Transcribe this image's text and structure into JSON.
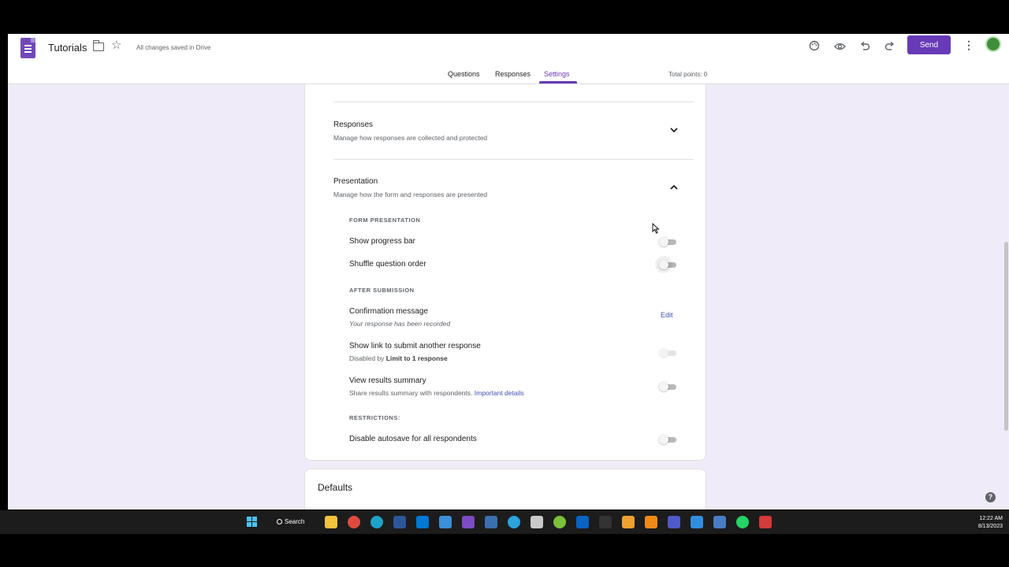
{
  "header": {
    "title": "Tutorials",
    "save_status": "All changes saved in Drive",
    "send_label": "Send",
    "icons": [
      "palette-icon",
      "preview-eye-icon",
      "undo-icon",
      "redo-icon",
      "more-vert-icon"
    ]
  },
  "tabs": [
    {
      "label": "Questions"
    },
    {
      "label": "Responses"
    },
    {
      "label": "Settings",
      "active": true
    }
  ],
  "total_points": "Total points: 0",
  "sections": {
    "responses": {
      "title": "Responses",
      "subtitle": "Manage how responses are collected and protected",
      "expanded": false
    },
    "presentation": {
      "title": "Presentation",
      "subtitle": "Manage how the form and responses are presented",
      "expanded": true,
      "form_presentation_label": "FORM PRESENTATION",
      "show_progress_bar": {
        "label": "Show progress bar",
        "on": false
      },
      "shuffle_question_order": {
        "label": "Shuffle question order",
        "on": false
      },
      "after_submission_label": "AFTER SUBMISSION",
      "confirmation_message": {
        "label": "Confirmation message",
        "value": "Your response has been recorded",
        "edit_label": "Edit"
      },
      "show_link": {
        "label": "Show link to submit another response",
        "sub_prefix": "Disabled by ",
        "sub_bold": "Limit to 1 response",
        "on": false,
        "disabled": true
      },
      "view_results": {
        "label": "View results summary",
        "sub_text": "Share results summary with respondents.",
        "sub_link": "Important details",
        "on": false
      },
      "restrictions_label": "RESTRICTIONS:",
      "disable_autosave": {
        "label": "Disable autosave for all respondents",
        "on": false
      }
    },
    "defaults": {
      "title": "Defaults"
    }
  },
  "colors": {
    "accent": "#673ab7",
    "background": "#f0ebf8",
    "link": "#3f51b5"
  },
  "taskbar": {
    "search_label": "Search",
    "time": "12:22 AM",
    "date": "8/13/2023"
  }
}
